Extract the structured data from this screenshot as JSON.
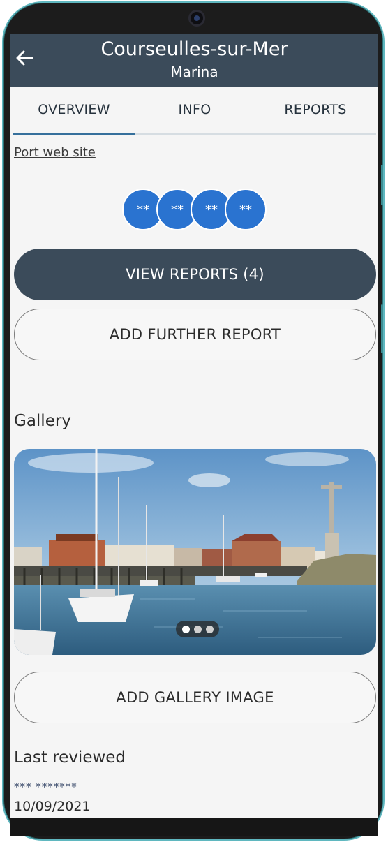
{
  "header": {
    "title": "Courseulles-sur-Mer",
    "subtitle": "Marina",
    "back_icon": "arrow-left-icon"
  },
  "tabs": [
    {
      "label": "OVERVIEW",
      "selected": true
    },
    {
      "label": "INFO",
      "selected": false
    },
    {
      "label": "REPORTS",
      "selected": false
    }
  ],
  "overview": {
    "port_link": "Port web site",
    "reviewer_avatars": [
      "**",
      "**",
      "**",
      "**"
    ],
    "view_reports_label": "VIEW REPORTS (4)",
    "add_report_label": "ADD FURTHER REPORT",
    "gallery_title": "Gallery",
    "gallery_image_alt": "Harbour with sailing boats",
    "gallery_pages": 3,
    "gallery_current_page": 1,
    "add_gallery_label": "ADD GALLERY IMAGE",
    "last_reviewed_title": "Last reviewed",
    "last_reviewed_by": "*** *******",
    "last_reviewed_date": "10/09/2021"
  },
  "colors": {
    "appbar": "#3b4b5a",
    "tab_indicator": "#36709c",
    "avatar": "#2a73d0",
    "frame_accent": "#5fb7bf"
  }
}
